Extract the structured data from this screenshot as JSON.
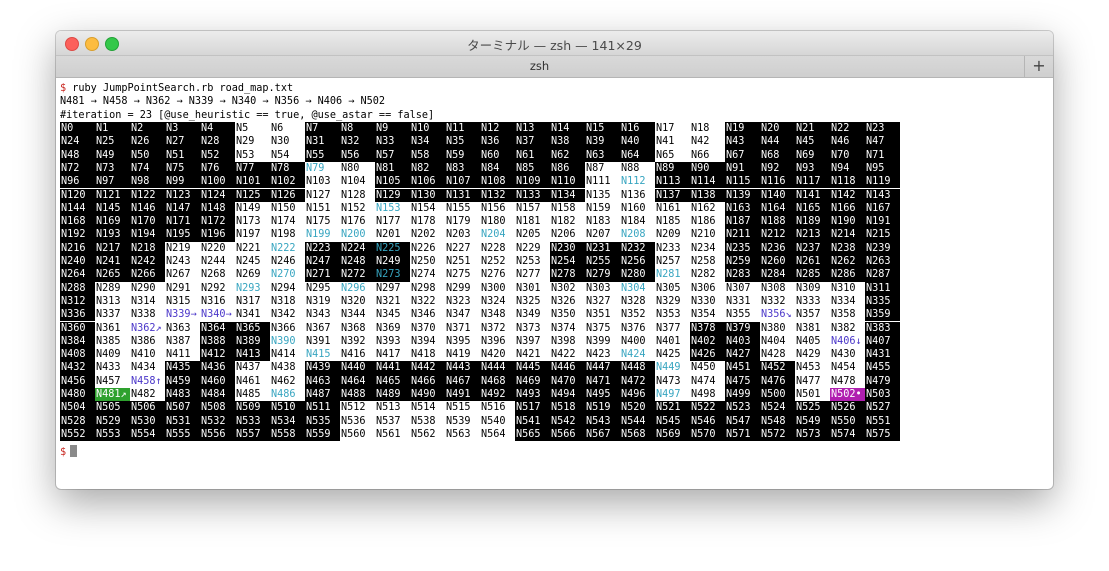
{
  "window": {
    "title": "ターミナル — zsh — 141×29",
    "tab_label": "zsh",
    "new_tab_symbol": "+"
  },
  "terminal": {
    "prompt_symbol": "$",
    "command": "ruby JumpPointSearch.rb road_map.txt",
    "path_line": "N481 → N458 → N362 → N339 → N340 → N356 → N406 → N502",
    "iteration_line": "#iteration = 23 [@use_heuristic == true, @use_astar == false]",
    "grid": {
      "columns": 24,
      "rows": 24,
      "blocked": [
        [
          0,
          1,
          2,
          3,
          4,
          7,
          8,
          9,
          10,
          11,
          12,
          13,
          14,
          15,
          16,
          19,
          20,
          21,
          22,
          23
        ],
        [
          0,
          1,
          2,
          3,
          4,
          7,
          8,
          9,
          10,
          11,
          12,
          13,
          14,
          15,
          16,
          19,
          20,
          21,
          22,
          23
        ],
        [
          0,
          1,
          2,
          3,
          4,
          7,
          8,
          9,
          10,
          11,
          12,
          13,
          14,
          15,
          16,
          19,
          20,
          21,
          22,
          23
        ],
        [
          0,
          1,
          2,
          3,
          4,
          5,
          6,
          9,
          10,
          11,
          12,
          13,
          14,
          17,
          18,
          19,
          20,
          21,
          22,
          23
        ],
        [
          0,
          1,
          2,
          3,
          4,
          5,
          6,
          9,
          10,
          11,
          12,
          13,
          14,
          17,
          18,
          19,
          20,
          21,
          22,
          23
        ],
        [
          0,
          1,
          2,
          3,
          4,
          5,
          6,
          9,
          10,
          11,
          12,
          13,
          14,
          17,
          18,
          19,
          20,
          21,
          22,
          23
        ],
        [
          0,
          1,
          2,
          3,
          4,
          19,
          20,
          21,
          22,
          23
        ],
        [
          0,
          1,
          2,
          3,
          4,
          19,
          20,
          21,
          22,
          23
        ],
        [
          0,
          1,
          2,
          3,
          4,
          19,
          20,
          21,
          22,
          23
        ],
        [
          0,
          1,
          2,
          7,
          8,
          9,
          14,
          15,
          16,
          19,
          20,
          21,
          22,
          23
        ],
        [
          0,
          1,
          2,
          7,
          8,
          9,
          14,
          15,
          16,
          19,
          20,
          21,
          22,
          23
        ],
        [
          0,
          1,
          2,
          7,
          8,
          9,
          14,
          15,
          16,
          19,
          20,
          21,
          22,
          23
        ],
        [
          0,
          23
        ],
        [
          0,
          23
        ],
        [
          0,
          23
        ],
        [
          0,
          4,
          5,
          18,
          19,
          23
        ],
        [
          0,
          4,
          5,
          18,
          19,
          23
        ],
        [
          0,
          4,
          5,
          18,
          19,
          23
        ],
        [
          0,
          3,
          4,
          7,
          8,
          9,
          10,
          11,
          12,
          13,
          14,
          15,
          16,
          19,
          20,
          23
        ],
        [
          0,
          3,
          4,
          7,
          8,
          9,
          10,
          11,
          12,
          13,
          14,
          15,
          16,
          19,
          20,
          23
        ],
        [
          0,
          3,
          4,
          7,
          8,
          9,
          10,
          11,
          12,
          13,
          14,
          15,
          16,
          19,
          20,
          23
        ],
        [
          0,
          1,
          2,
          3,
          4,
          5,
          6,
          7,
          13,
          14,
          15,
          16,
          17,
          18,
          19,
          20,
          21,
          22,
          23
        ],
        [
          0,
          1,
          2,
          3,
          4,
          5,
          6,
          7,
          13,
          14,
          15,
          16,
          17,
          18,
          19,
          20,
          21,
          22,
          23
        ],
        [
          0,
          1,
          2,
          3,
          4,
          5,
          6,
          7,
          13,
          14,
          15,
          16,
          17,
          18,
          19,
          20,
          21,
          22,
          23
        ]
      ],
      "open_set": [
        79,
        112,
        153,
        199,
        200,
        204,
        208,
        222,
        225,
        270,
        273,
        281,
        293,
        296,
        304,
        390,
        415,
        424,
        449,
        486,
        497
      ],
      "path_markers": {
        "362": "↗",
        "339": "→",
        "340": "→",
        "356": "↘",
        "406": "↓",
        "458": "↑"
      },
      "start": {
        "id": 481,
        "marker": "↗"
      },
      "goal": {
        "id": 502,
        "marker": "•"
      }
    },
    "final_prompt": "$"
  },
  "colors": {
    "wall_bg": "#000000",
    "open_set_text": "#37a5c0",
    "path_text": "#4a36c9",
    "start_bg": "#2ea12e",
    "goal_bg": "#b01fb0",
    "prompt": "#c8261f"
  }
}
